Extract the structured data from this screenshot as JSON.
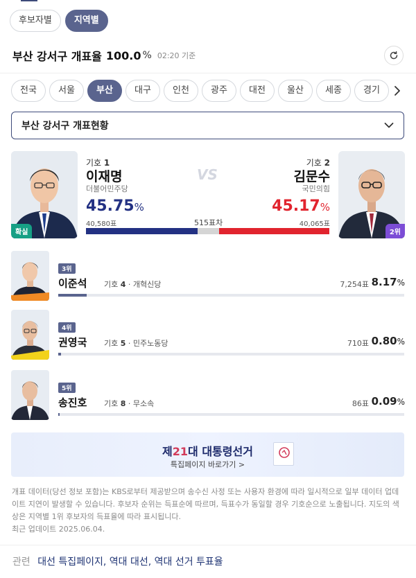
{
  "view_tabs": [
    {
      "label": "후보자별",
      "active": false
    },
    {
      "label": "지역별",
      "active": true
    }
  ],
  "header": {
    "title": "부산 강서구 개표율",
    "rate": "100.0",
    "rate_unit": "%",
    "time": "02:20 기준"
  },
  "regions": [
    {
      "label": "전국",
      "active": false
    },
    {
      "label": "서울",
      "active": false
    },
    {
      "label": "부산",
      "active": true
    },
    {
      "label": "대구",
      "active": false
    },
    {
      "label": "인천",
      "active": false
    },
    {
      "label": "광주",
      "active": false
    },
    {
      "label": "대전",
      "active": false
    },
    {
      "label": "울산",
      "active": false
    },
    {
      "label": "세종",
      "active": false
    },
    {
      "label": "경기",
      "active": false
    }
  ],
  "district_select": {
    "label": "부산 강서구 개표현황"
  },
  "main_race": {
    "vs_label": "VS",
    "gap": "515표차",
    "left": {
      "number_prefix": "기호",
      "number": "1",
      "name": "이재명",
      "party": "더불어민주당",
      "pct": "45.75",
      "pct_unit": "%",
      "votes": "40,580표",
      "badge": "확실",
      "color": "#233183"
    },
    "right": {
      "number_prefix": "기호",
      "number": "2",
      "name": "김문수",
      "party": "국민의힘",
      "pct": "45.17",
      "pct_unit": "%",
      "votes": "40,065표",
      "badge": "2위",
      "color": "#e1242e"
    },
    "gap_color": "#d5d5d5",
    "left_share": 45.75,
    "gap_share": 9.08,
    "right_share": 45.17
  },
  "others": [
    {
      "rank": "3위",
      "name": "이준석",
      "number_prefix": "기호",
      "number": "4",
      "party": "개혁신당",
      "votes": "7,254표",
      "pct": "8.17",
      "pct_unit": "%",
      "share": 8.17
    },
    {
      "rank": "4위",
      "name": "권영국",
      "number_prefix": "기호",
      "number": "5",
      "party": "민주노동당",
      "votes": "710표",
      "pct": "0.80",
      "pct_unit": "%",
      "share": 0.8
    },
    {
      "rank": "5위",
      "name": "송진호",
      "number_prefix": "기호",
      "number": "8",
      "party": "무소속",
      "votes": "86표",
      "pct": "0.09",
      "pct_unit": "%",
      "share": 0.09
    }
  ],
  "banner": {
    "title_pre": "제",
    "title_num": "21",
    "title_post": "대 대통령선거",
    "subtitle": "특집페이지 바로가기 >"
  },
  "notice": "개표 데이터(당선 정보 포함)는 KBS로부터 제공받으며 송수신 사정 또는 사용자 환경에 따라 일시적으로 일부 데이터 업데이트 지연이 발생할 수 있습니다. 후보자 순위는 득표순에 따르며, 득표수가 동일할 경우 기호순으로 노출됩니다. 지도의 색상은 지역별 1위 후보자의 득표율에 따라 표시됩니다.",
  "last_update": "최근 업데이트 2025.06.04.",
  "related": {
    "prefix": "관련",
    "links": [
      "대선 특집페이지,",
      "역대 대선,",
      "역대 선거 투표율"
    ]
  },
  "colors": {
    "accent": "#5a648e",
    "democratic_blue": "#233183",
    "ppp_red": "#e1242e",
    "confirmed_green": "#16a085",
    "rank2_purple": "#7c4dd6"
  },
  "icons": [
    "refresh-icon",
    "chevron-right-icon",
    "chevron-down-icon"
  ]
}
